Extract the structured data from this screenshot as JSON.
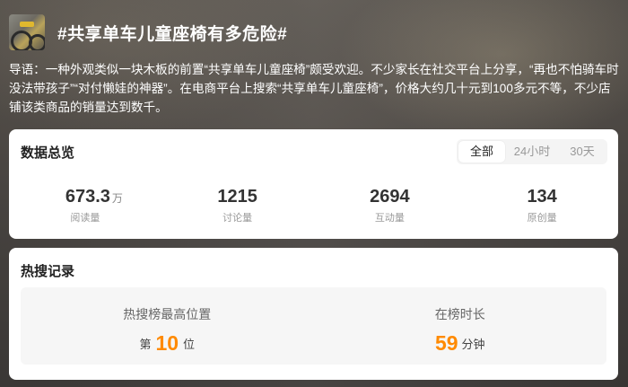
{
  "topic": {
    "title": "#共享单车儿童座椅有多危险#",
    "thumbnail_icon": "bicycle-thumbnail",
    "intro": "导语：一种外观类似一块木板的前置“共享单车儿童座椅”颇受欢迎。不少家长在社交平台上分享，“再也不怕骑车时没法带孩子”“对付懒娃的神器”。在电商平台上搜索“共享单车儿童座椅”，价格大约几十元到100多元不等，不少店铺该类商品的销量达到数千。"
  },
  "overview": {
    "title": "数据总览",
    "tabs": [
      {
        "label": "全部",
        "active": true
      },
      {
        "label": "24小时",
        "active": false
      },
      {
        "label": "30天",
        "active": false
      }
    ],
    "stats": [
      {
        "value": "673.3",
        "unit": "万",
        "label": "阅读量"
      },
      {
        "value": "1215",
        "unit": "",
        "label": "讨论量"
      },
      {
        "value": "2694",
        "unit": "",
        "label": "互动量"
      },
      {
        "value": "134",
        "unit": "",
        "label": "原创量"
      }
    ]
  },
  "hot_search": {
    "title": "热搜记录",
    "highest_rank_label": "热搜榜最高位置",
    "rank_prefix": "第",
    "rank_value": "10",
    "rank_suffix": "位",
    "duration_label": "在榜时长",
    "duration_value": "59",
    "duration_unit": "分钟"
  },
  "colors": {
    "accent": "#ff8a00",
    "card_bg": "#ffffff",
    "tab_bg": "#f4f4f4"
  }
}
